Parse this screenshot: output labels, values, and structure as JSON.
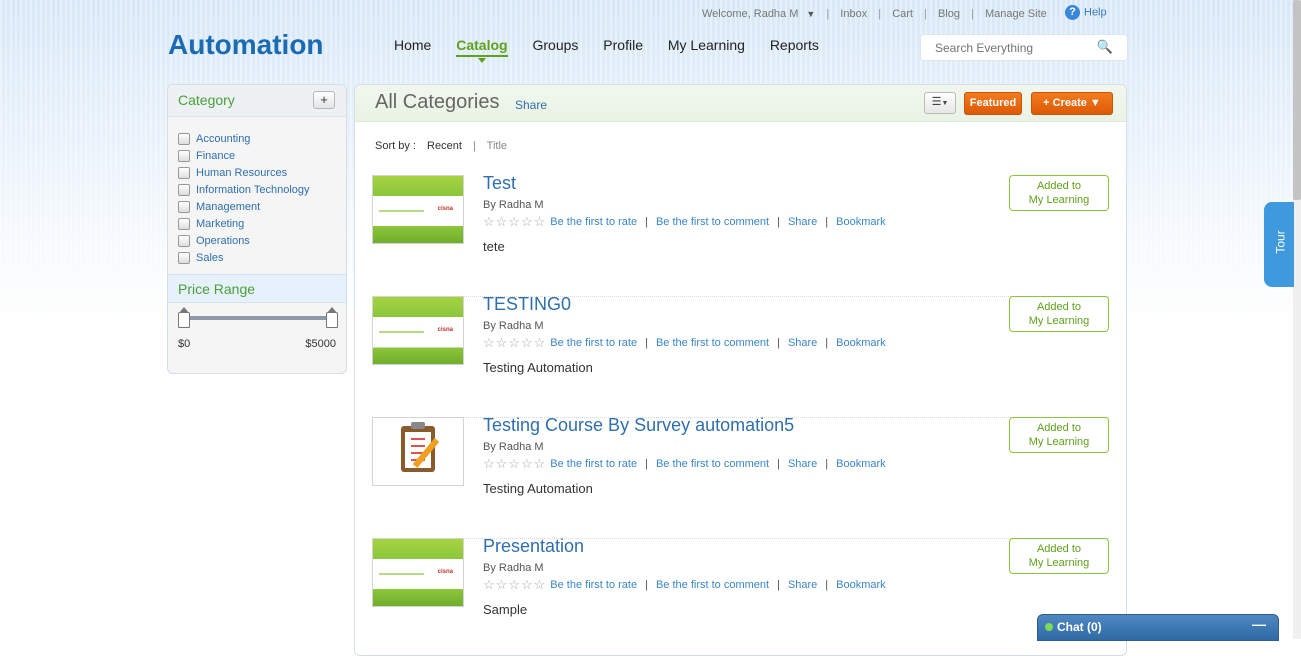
{
  "utility": {
    "welcome": "Welcome, Radha M",
    "links": [
      "Inbox",
      "Cart",
      "Blog",
      "Manage Site"
    ],
    "help": "Help"
  },
  "header": {
    "logo": "Automation",
    "nav": [
      "Home",
      "Catalog",
      "Groups",
      "Profile",
      "My Learning",
      "Reports"
    ],
    "active_nav": "Catalog",
    "search_placeholder": "Search Everything"
  },
  "sidebar": {
    "category_title": "Category",
    "add_label": "+",
    "categories": [
      "Accounting",
      "Finance",
      "Human Resources",
      "Information Technology",
      "Management",
      "Marketing",
      "Operations",
      "Sales"
    ],
    "price_title": "Price Range",
    "price_min": "$0",
    "price_max": "$5000"
  },
  "main": {
    "title": "All Categories",
    "share": "Share",
    "featured": "Featured",
    "create": "+ Create ▼",
    "sort_label": "Sort by :",
    "sort_current": "Recent",
    "sort_alt": "Title",
    "items": [
      {
        "title": "Test",
        "by": "By Radha M",
        "desc": "tete",
        "rate": "Be the first to rate",
        "comment": "Be the first to comment",
        "share": "Share",
        "bookmark": "Bookmark",
        "added1": "Added to",
        "added2": "My Learning",
        "thumb": "slide"
      },
      {
        "title": "TESTING0",
        "by": "By Radha M",
        "desc": "Testing Automation",
        "rate": "Be the first to rate",
        "comment": "Be the first to comment",
        "share": "Share",
        "bookmark": "Bookmark",
        "added1": "Added to",
        "added2": "My Learning",
        "thumb": "slide"
      },
      {
        "title": "Testing Course By Survey automation5",
        "by": "By Radha M",
        "desc": "Testing Automation",
        "rate": "Be the first to rate",
        "comment": "Be the first to comment",
        "share": "Share",
        "bookmark": "Bookmark",
        "added1": "Added to",
        "added2": "My Learning",
        "thumb": "survey"
      },
      {
        "title": "Presentation",
        "by": "By Radha M",
        "desc": "Sample",
        "rate": "Be the first to rate",
        "comment": "Be the first to comment",
        "share": "Share",
        "bookmark": "Bookmark",
        "added1": "Added to",
        "added2": "My Learning",
        "thumb": "slide"
      }
    ]
  },
  "tour": "Tour",
  "chat": "Chat  (0)",
  "chat_min": "—"
}
